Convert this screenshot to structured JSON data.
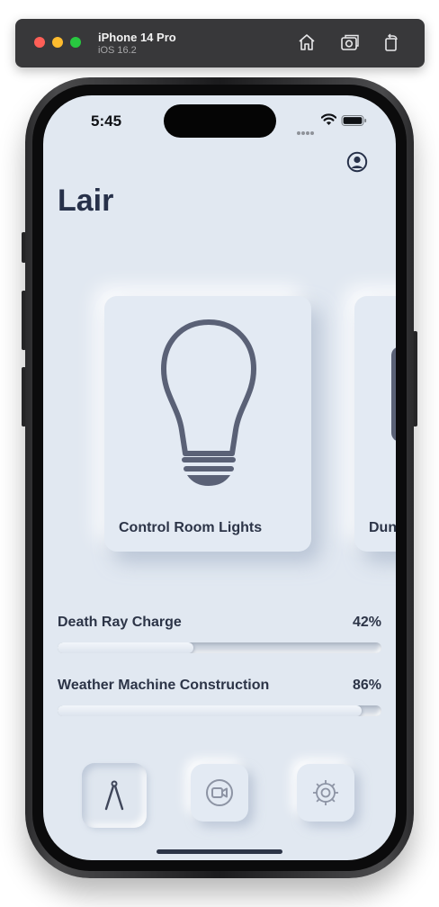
{
  "simulator": {
    "device_name": "iPhone 14 Pro",
    "os_version": "iOS 16.2",
    "toolbar_icons": [
      "home-icon",
      "screenshot-icon",
      "rotate-icon"
    ]
  },
  "status_bar": {
    "time": "5:45",
    "icons": [
      "cellular-icon",
      "wifi-icon",
      "battery-icon"
    ]
  },
  "header": {
    "title": "Lair",
    "profile_icon": "person-circle-icon"
  },
  "cards": [
    {
      "label": "Control Room Lights",
      "icon": "lightbulb-icon"
    },
    {
      "label": "Dun",
      "icon": "unknown-device-icon"
    }
  ],
  "metrics": [
    {
      "label": "Death Ray Charge",
      "value": "42%",
      "progress": 0.42
    },
    {
      "label": "Weather Machine Construction",
      "value": "86%",
      "progress": 0.94
    }
  ],
  "tab_bar": {
    "tabs": [
      {
        "icon": "compass-icon",
        "selected": true
      },
      {
        "icon": "video-icon",
        "selected": false
      },
      {
        "icon": "gear-icon",
        "selected": false
      }
    ]
  },
  "colors": {
    "background": "#e1e8f1",
    "text": "#2c3447",
    "title": "#27314a"
  }
}
